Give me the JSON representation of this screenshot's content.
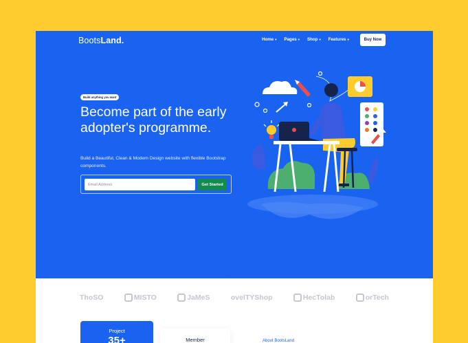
{
  "nav": {
    "brand_light": "Boots",
    "brand_bold": "Land.",
    "menu": [
      {
        "label": "Home",
        "caret": "▾"
      },
      {
        "label": "Pages",
        "caret": "▾"
      },
      {
        "label": "Shop",
        "caret": "▾"
      },
      {
        "label": "Features",
        "caret": "▾"
      }
    ],
    "buy_label": "Buy Now"
  },
  "hero": {
    "badge": "Build anything you want",
    "headline": "Become part of the early adopter's programme.",
    "subtext": "Build a Beautiful, Clean & Modern Design website with flexible Bootstrap components.",
    "email_placeholder": "Email Address",
    "cta_label": "Get Started"
  },
  "logos": [
    {
      "name": "ThoSO",
      "icon": "thoso-logo-icon"
    },
    {
      "name": "MISTO",
      "icon": "misto-logo-icon"
    },
    {
      "name": "JaMeS",
      "icon": "james-logo-icon"
    },
    {
      "name": "ovelTYShop",
      "icon": "ovelty-logo-icon"
    },
    {
      "name": "HecTolab",
      "icon": "hectolab-logo-icon"
    },
    {
      "name": "orTech",
      "icon": "hortech-logo-icon"
    }
  ],
  "stats": {
    "project_title": "Project",
    "project_value": "35+",
    "member_title": "Member",
    "about_link": "About BootsLand"
  },
  "colors": {
    "page_background": "#FFCC2E",
    "hero_blue": "#1A63F0",
    "cta_green": "#138a4e",
    "logo_gray": "#c4c7cf",
    "dark_text": "#16234a"
  }
}
